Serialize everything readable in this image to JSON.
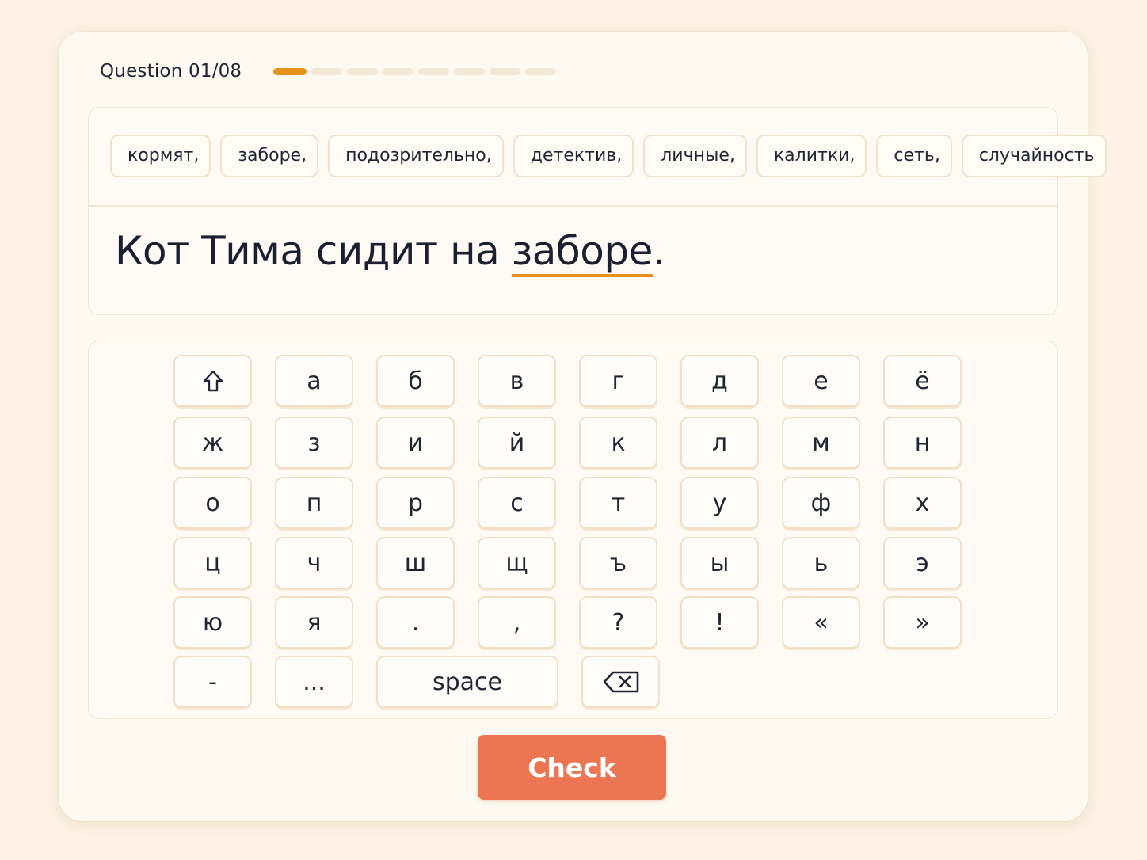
{
  "header": {
    "question_label": "Question 01/08",
    "total_questions": 8,
    "current_question": 1
  },
  "word_bank": [
    "кормят,",
    "заборе,",
    "подозрительно,",
    "детектив,",
    "личные,",
    "калитки,",
    "сеть,",
    "случайность"
  ],
  "sentence": {
    "before": "Кот Тима сидит на ",
    "filled": "заборе",
    "after": "."
  },
  "keyboard": {
    "rows": [
      [
        "shift-icon",
        "а",
        "б",
        "в",
        "г",
        "д",
        "е",
        "ё"
      ],
      [
        "ж",
        "з",
        "и",
        "й",
        "к",
        "л",
        "м",
        "н"
      ],
      [
        "о",
        "п",
        "р",
        "с",
        "т",
        "у",
        "ф",
        "х"
      ],
      [
        "ц",
        "ч",
        "ш",
        "щ",
        "ъ",
        "ы",
        "ь",
        "э"
      ],
      [
        "ю",
        "я",
        ".",
        ",",
        "?",
        "!",
        "«",
        "»"
      ],
      [
        "-",
        "...",
        "space",
        "backspace-icon"
      ]
    ]
  },
  "colors": {
    "accent": "#e8921e",
    "check_button": "#ec7652",
    "background": "#fcf3e6",
    "card": "#fefaf2"
  },
  "check_label": "Check"
}
